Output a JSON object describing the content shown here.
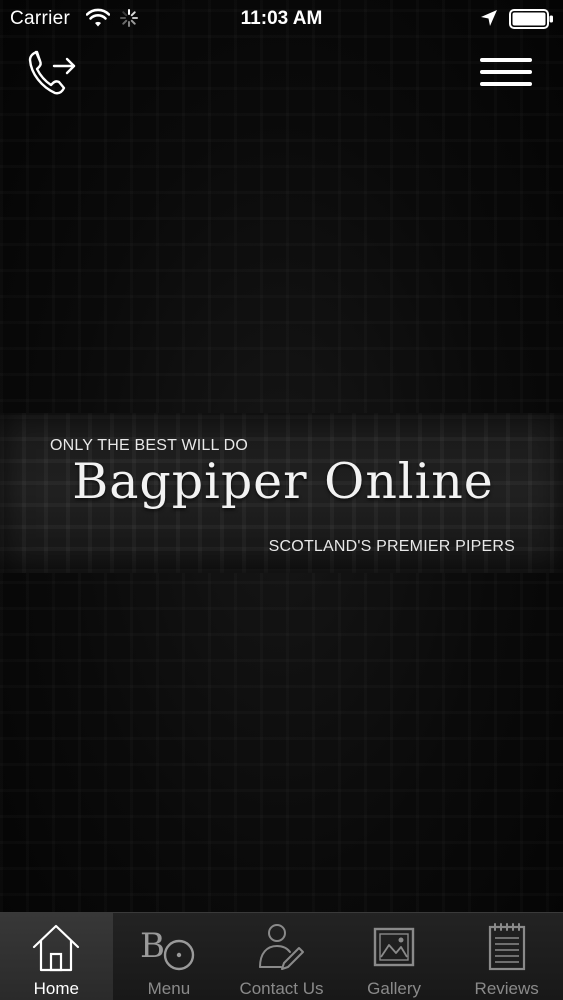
{
  "status_bar": {
    "carrier": "Carrier",
    "time": "11:03 AM"
  },
  "header": {
    "call_icon": "phone-forward-icon",
    "menu_icon": "hamburger-menu-icon"
  },
  "banner": {
    "tagline": "ONLY THE BEST WILL DO",
    "brand": "Bagpiper Online",
    "subtitle": "SCOTLAND'S PREMIER PIPERS"
  },
  "tabs": [
    {
      "label": "Home",
      "icon": "home-icon",
      "active": true
    },
    {
      "label": "Menu",
      "icon": "bo-logo-icon",
      "active": false
    },
    {
      "label": "Contact Us",
      "icon": "contact-person-icon",
      "active": false
    },
    {
      "label": "Gallery",
      "icon": "gallery-image-icon",
      "active": false
    },
    {
      "label": "Reviews",
      "icon": "notepad-icon",
      "active": false
    }
  ],
  "colors": {
    "background": "#050505",
    "tab_bar": "#1c1c1c",
    "tab_active": "#333333",
    "text_primary": "#ffffff",
    "text_inactive": "#8a8a8a"
  }
}
